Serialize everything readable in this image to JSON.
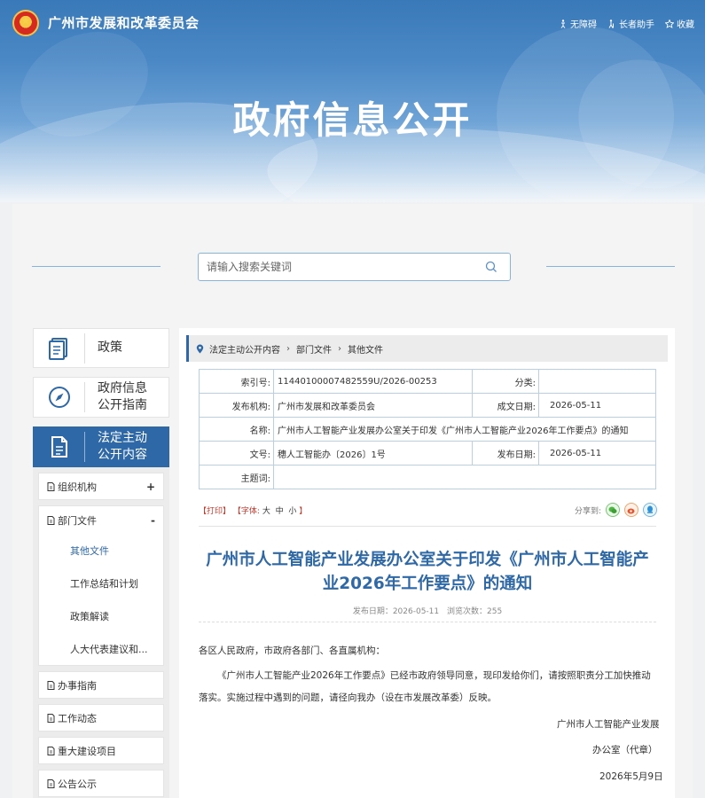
{
  "header": {
    "site_name": "广州市发展和改革委员会",
    "page_heading": "政府信息公开",
    "util_links": [
      {
        "label": "无障碍",
        "icon": "accessibility-icon"
      },
      {
        "label": "长者助手",
        "icon": "elder-assist-icon"
      },
      {
        "label": "收藏",
        "icon": "star-icon"
      }
    ]
  },
  "search": {
    "placeholder": "请输入搜索关键词"
  },
  "sidebar": {
    "cards": [
      {
        "label": "政策",
        "icon": "document-stack-icon"
      },
      {
        "label_line1": "政府信息",
        "label_line2": "公开指南",
        "icon": "compass-icon"
      },
      {
        "label_line1": "法定主动",
        "label_line2": "公开内容",
        "icon": "file-list-icon"
      }
    ],
    "items": [
      {
        "label": "组织机构",
        "toggle": "+"
      },
      {
        "label": "部门文件",
        "toggle": "-",
        "children": [
          "其他文件",
          "工作总结和计划",
          "政策解读",
          "人大代表建议和..."
        ]
      },
      {
        "label": "办事指南"
      },
      {
        "label": "工作动态"
      },
      {
        "label": "重大建设项目"
      },
      {
        "label": "公告公示"
      }
    ]
  },
  "breadcrumb": [
    "法定主动公开内容",
    "部门文件",
    "其他文件"
  ],
  "meta": {
    "index_no_label": "索引号:",
    "index_no": "11440100007482559U/2026-00253",
    "category_label": "分类:",
    "category": "",
    "publisher_label": "发布机构:",
    "publisher": "广州市发展和改革委员会",
    "created_label": "成文日期:",
    "created": "2026-05-11",
    "name_label": "名称:",
    "name": "广州市人工智能产业发展办公室关于印发《广州市人工智能产业2026年工作要点》的通知",
    "doc_no_label": "文号:",
    "doc_no": "穗人工智能办〔2026〕1号",
    "published_label": "发布日期:",
    "published": "2026-05-11",
    "keywords_label": "主题词:",
    "keywords": ""
  },
  "toolbar": {
    "print": "【打印】",
    "font_prefix": "【字体:",
    "font_large": "大",
    "font_medium": "中",
    "font_small": "小",
    "font_suffix": "】",
    "share_label": "分享到:"
  },
  "article": {
    "title": "广州市人工智能产业发展办公室关于印发《广州市人工智能产业2026年工作要点》的通知",
    "publish_date": "发布日期：2026-05-11",
    "views": "浏览次数：255",
    "salutation": "各区人民政府，市政府各部门、各直属机构：",
    "paragraph": "《广州市人工智能产业2026年工作要点》已经市政府领导同意，现印发给你们，请按照职责分工加快推动落实。实施过程中遇到的问题，请径向我办（设在市发展改革委）反映。",
    "sign_line1": "广州市人工智能产业发展",
    "sign_line2": "办公室（代章）",
    "sign_date": "2026年5月9日"
  },
  "colors": {
    "brand_blue": "#2f68a6",
    "banner_blue": "#4a88c5",
    "print_red": "#c0392b"
  }
}
